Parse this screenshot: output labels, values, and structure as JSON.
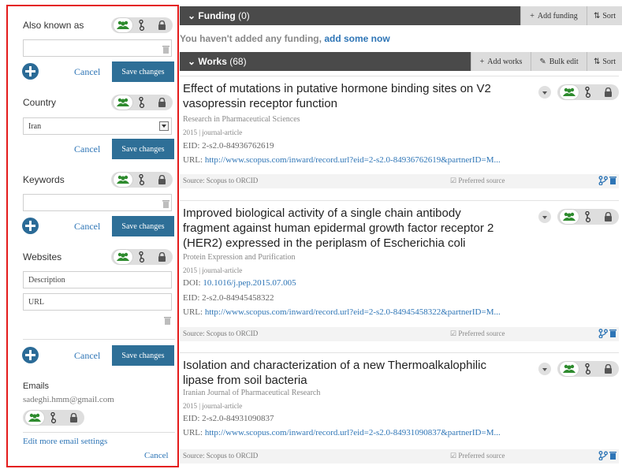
{
  "left_panel": {
    "also_known_as": {
      "label": "Also known as",
      "value": "",
      "cancel": "Cancel",
      "save": "Save changes"
    },
    "country": {
      "label": "Country",
      "value": "Iran",
      "cancel": "Cancel",
      "save": "Save changes"
    },
    "keywords": {
      "label": "Keywords",
      "value": "",
      "cancel": "Cancel",
      "save": "Save changes"
    },
    "websites": {
      "label": "Websites",
      "description_placeholder": "Description",
      "url_placeholder": "URL",
      "cancel": "Cancel",
      "save": "Save changes"
    },
    "emails": {
      "label": "Emails",
      "email": "sadeghi.hmm@gmail.com",
      "edit_link": "Edit more email settings",
      "cancel": "Cancel"
    },
    "privacy_icons": [
      "everyone-icon",
      "trusted-parties-icon",
      "lock-icon"
    ]
  },
  "funding": {
    "title": "Funding",
    "count": "(0)",
    "add_button": "Add funding",
    "sort_button": "Sort",
    "empty_text": "You haven't added any funding, ",
    "empty_link": "add some now"
  },
  "works": {
    "title": "Works",
    "count": "(68)",
    "add_button": "Add works",
    "bulk_button": "Bulk edit",
    "sort_button": "Sort",
    "items": [
      {
        "title": "Effect of mutations in putative hormone binding sites on V2 vasopressin receptor function",
        "journal": "Research in Pharmaceutical Sciences",
        "year_type": "2015 | journal-article",
        "doi_label": "",
        "doi_value": "",
        "eid": "EID: 2-s2.0-84936762619",
        "url_label": "URL: ",
        "url_value": "http://www.scopus.com/inward/record.url?eid=2-s2.0-84936762619&partnerID=M...",
        "source": "Source: Scopus to ORCID",
        "preferred": "Preferred source"
      },
      {
        "title": "Improved biological activity of a single chain antibody fragment against human epidermal growth factor receptor 2 (HER2) expressed in the periplasm of Escherichia coli",
        "journal": "Protein Expression and Purification",
        "year_type": "2015 | journal-article",
        "doi_label": "DOI: ",
        "doi_value": "10.1016/j.pep.2015.07.005",
        "eid": "EID: 2-s2.0-84945458322",
        "url_label": "URL: ",
        "url_value": "http://www.scopus.com/inward/record.url?eid=2-s2.0-84945458322&partnerID=M...",
        "source": "Source: Scopus to ORCID",
        "preferred": "Preferred source"
      },
      {
        "title": "Isolation and characterization of a new Thermoalkalophilic lipase from soil bacteria",
        "journal": "Iranian Journal of Pharmaceutical Research",
        "year_type": "2015 | journal-article",
        "doi_label": "",
        "doi_value": "",
        "eid": "EID: 2-s2.0-84931090837",
        "url_label": "URL: ",
        "url_value": "http://www.scopus.com/inward/record.url?eid=2-s2.0-84931090837&partnerID=M...",
        "source": "Source: Scopus to ORCID",
        "preferred": "Preferred source"
      }
    ]
  },
  "colors": {
    "accent": "#2e6f97",
    "link": "#2e75b6",
    "privacy_green": "#2e8b2e",
    "highlight_border": "#e41b1b",
    "bar_bg": "#4a4a4a"
  }
}
